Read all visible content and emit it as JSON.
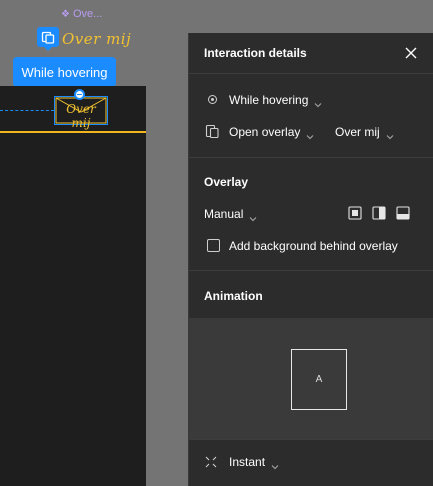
{
  "canvas": {
    "component_tag": "Ove...",
    "component_title": "Over mij",
    "hover_pill_label": "While hovering",
    "envelope_text": "Over mij"
  },
  "panel": {
    "title": "Interaction details",
    "trigger": {
      "label": "While hovering",
      "icon": "hover-target-icon"
    },
    "action": {
      "label": "Open overlay",
      "icon": "overlay-icon"
    },
    "destination": {
      "label": "Over mij"
    },
    "overlay_section": {
      "title": "Overlay",
      "position_label": "Manual",
      "position_options": [
        "center",
        "left",
        "bottom"
      ],
      "background_checkbox_label": "Add background behind overlay",
      "background_checked": false
    },
    "animation_section": {
      "title": "Animation",
      "preview_label": "A",
      "animation_label": "Instant"
    }
  },
  "colors": {
    "accent_blue": "#1a8cff",
    "panel_bg": "#2c2c2c",
    "canvas_bg": "#757474",
    "frame_bg": "#1e1e1e",
    "yellow_text": "#f2c230",
    "purple_tag": "#b79cf0"
  }
}
